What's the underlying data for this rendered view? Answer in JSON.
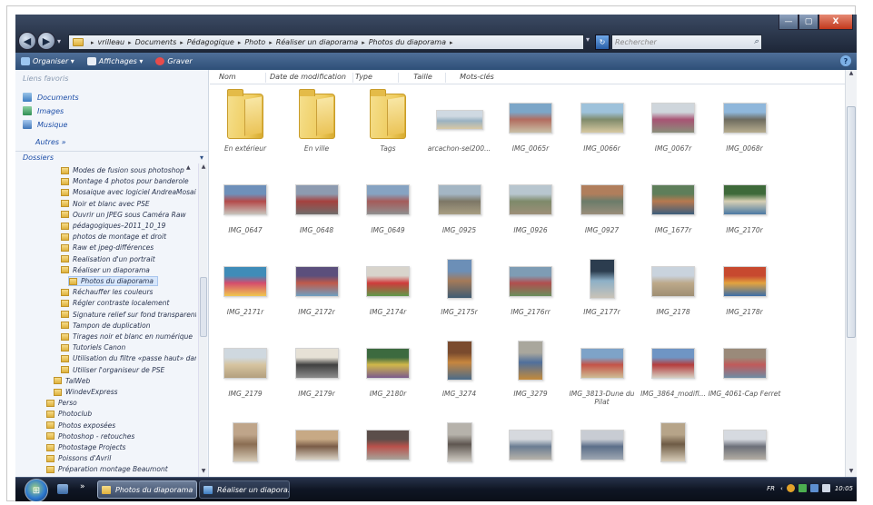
{
  "window": {
    "min_label": "—",
    "max_label": "▢",
    "close_label": "X"
  },
  "breadcrumb": [
    "vrilleau",
    "Documents",
    "Pédagogique",
    "Photo",
    "Réaliser un diaporama",
    "Photos du diaporama"
  ],
  "search": {
    "placeholder": "Rechercher"
  },
  "toolbar": {
    "organize_label": "Organiser ▾",
    "views_label": "Affichages ▾",
    "burn_label": "Graver"
  },
  "favorites": {
    "title": "Liens favoris",
    "items": [
      "Documents",
      "Images",
      "Musique"
    ],
    "more_label": "Autres »"
  },
  "folders_header": "Dossiers",
  "tree": [
    {
      "label": "Modes de fusion sous photoshop",
      "level": 1
    },
    {
      "label": "Montage 4 photos pour banderole",
      "level": 1
    },
    {
      "label": "Mosaique avec logiciel AndreaMosaic",
      "level": 1
    },
    {
      "label": "Noir et blanc avec PSE",
      "level": 1
    },
    {
      "label": "Ouvrir un JPEG sous Caméra Raw",
      "level": 1
    },
    {
      "label": "pédagogiques–2011_10_19",
      "level": 1
    },
    {
      "label": "photos de montage et droit",
      "level": 1
    },
    {
      "label": "Raw et jpeg-différences",
      "level": 1
    },
    {
      "label": "Realisation d'un portrait",
      "level": 1
    },
    {
      "label": "Réaliser un diaporama",
      "level": 1
    },
    {
      "label": "Photos du diaporama",
      "level": 2,
      "selected": true
    },
    {
      "label": "Réchauffer les couleurs",
      "level": 1
    },
    {
      "label": "Régler contraste localement",
      "level": 1
    },
    {
      "label": "Signature relief sur fond transparent",
      "level": 1
    },
    {
      "label": "Tampon de duplication",
      "level": 1
    },
    {
      "label": "Tirages noir et blanc en numérique",
      "level": 1
    },
    {
      "label": "Tutoriels Canon",
      "level": 1
    },
    {
      "label": "Utilisation du filtre «passe haut» dans",
      "level": 1
    },
    {
      "label": "Utiliser l'organiseur de PSE",
      "level": 1
    },
    {
      "label": "TalWeb",
      "level": 0
    },
    {
      "label": "WindevExpress",
      "level": 0
    },
    {
      "label": "Perso",
      "level": -1
    },
    {
      "label": "Photoclub",
      "level": -1
    },
    {
      "label": "Photos exposées",
      "level": -1
    },
    {
      "label": "Photoshop - retouches",
      "level": -1
    },
    {
      "label": "Photostage Projects",
      "level": -1
    },
    {
      "label": "Poissons d'Avril",
      "level": -1
    },
    {
      "label": "Préparation montage Beaumont",
      "level": -1
    }
  ],
  "columns": [
    "Nom",
    "Date de modification",
    "Type",
    "Taille",
    "Mots-clés"
  ],
  "items": [
    {
      "name": "En extérieur",
      "kind": "folder"
    },
    {
      "name": "En ville",
      "kind": "folder"
    },
    {
      "name": "Tags",
      "kind": "folder"
    },
    {
      "name": "arcachon-sel200...",
      "kind": "photo",
      "colors": [
        "#cfd9e2",
        "#9ab2c2",
        "#d8c8a4"
      ]
    },
    {
      "name": "IMG_0065r",
      "kind": "photo",
      "colors": [
        "#7ca6c8",
        "#b26c5f",
        "#c9c0a6"
      ]
    },
    {
      "name": "IMG_0066r",
      "kind": "photo",
      "colors": [
        "#9ec2db",
        "#7f8a6b",
        "#d7c9a1"
      ]
    },
    {
      "name": "IMG_0067r",
      "kind": "photo",
      "colors": [
        "#cfd6dc",
        "#a85374",
        "#8a8e7a"
      ]
    },
    {
      "name": "IMG_0068r",
      "kind": "photo",
      "colors": [
        "#8fb7db",
        "#6d6b5f",
        "#b7ad8f"
      ]
    },
    {
      "name": "IMG_0647",
      "kind": "photo",
      "colors": [
        "#6e90ba",
        "#b44a4a",
        "#c7c3bb"
      ]
    },
    {
      "name": "IMG_0648",
      "kind": "photo",
      "colors": [
        "#8d9bb0",
        "#a5413e",
        "#6f6d6b"
      ]
    },
    {
      "name": "IMG_0649",
      "kind": "photo",
      "colors": [
        "#86a3c2",
        "#a55b5a",
        "#8f8f8f"
      ]
    },
    {
      "name": "IMG_0925",
      "kind": "photo",
      "colors": [
        "#a4b6c4",
        "#7d7766",
        "#a89e82"
      ]
    },
    {
      "name": "IMG_0926",
      "kind": "photo",
      "colors": [
        "#b8c6cf",
        "#7e8a6a",
        "#9d8f78"
      ]
    },
    {
      "name": "IMG_0927",
      "kind": "photo",
      "colors": [
        "#b07e5c",
        "#6b7c6a",
        "#9a8d7a"
      ]
    },
    {
      "name": "IMG_1677r",
      "kind": "photo",
      "colors": [
        "#5e7e5a",
        "#b7794f",
        "#3c5d7c"
      ]
    },
    {
      "name": "IMG_2170r",
      "kind": "photo",
      "colors": [
        "#3e6a3a",
        "#d8d0b4",
        "#4a78a3"
      ]
    },
    {
      "name": "IMG_2171r",
      "kind": "photo",
      "colors": [
        "#3f8cb8",
        "#d54c6d",
        "#f0c74e"
      ]
    },
    {
      "name": "IMG_2172r",
      "kind": "photo",
      "colors": [
        "#5b4f7c",
        "#c05a4a",
        "#6e9fc1"
      ]
    },
    {
      "name": "IMG_2174r",
      "kind": "photo",
      "colors": [
        "#d8d4cc",
        "#cf3b3b",
        "#5f9a4a"
      ]
    },
    {
      "name": "IMG_2175r",
      "kind": "photo",
      "colors": [
        "#6c8fb7",
        "#a57a58",
        "#3f5c73"
      ],
      "portrait": true
    },
    {
      "name": "IMG_2176rr",
      "kind": "photo",
      "colors": [
        "#7e9cb4",
        "#b24e4e",
        "#6a8e5c"
      ]
    },
    {
      "name": "IMG_2177r",
      "kind": "photo",
      "colors": [
        "#2c3d4f",
        "#8db0c7",
        "#c9c2b7"
      ],
      "portrait": true
    },
    {
      "name": "IMG_2178",
      "kind": "photo",
      "colors": [
        "#c9d3dd",
        "#bda98a",
        "#9e8e73"
      ]
    },
    {
      "name": "IMG_2178r",
      "kind": "photo",
      "colors": [
        "#c7492f",
        "#e3a33f",
        "#3c6ea8"
      ]
    },
    {
      "name": "IMG_2179",
      "kind": "photo",
      "colors": [
        "#cfd8df",
        "#d6c4a0",
        "#b39f7e"
      ]
    },
    {
      "name": "IMG_2179r",
      "kind": "photo",
      "colors": [
        "#e6e1d6",
        "#404040",
        "#8c8c8c"
      ]
    },
    {
      "name": "IMG_2180r",
      "kind": "photo",
      "colors": [
        "#3c6a3f",
        "#d2b84a",
        "#7a5a8c"
      ]
    },
    {
      "name": "IMG_3274",
      "kind": "photo",
      "colors": [
        "#7a4b2e",
        "#c7863e",
        "#4a6b8a"
      ],
      "portrait": true
    },
    {
      "name": "IMG_3279",
      "kind": "photo",
      "colors": [
        "#a9a79d",
        "#4f6f9c",
        "#c48a3a"
      ],
      "portrait": true
    },
    {
      "name": "IMG_3813-Dune du Pilat",
      "kind": "photo",
      "colors": [
        "#7ea3c8",
        "#c45347",
        "#cdbd95"
      ]
    },
    {
      "name": "IMG_3864_modifi...",
      "kind": "photo",
      "colors": [
        "#6f95c4",
        "#b53d3d",
        "#d5cfc2"
      ]
    },
    {
      "name": "IMG_4061-Cap Ferret",
      "kind": "photo",
      "colors": [
        "#9a8a7a",
        "#c05a5a",
        "#6e8ca4"
      ]
    },
    {
      "name": "",
      "kind": "photo",
      "colors": [
        "#bfa58a",
        "#8a6d52",
        "#d7cbb7"
      ],
      "portrait": true
    },
    {
      "name": "",
      "kind": "photo",
      "colors": [
        "#c7a985",
        "#7a5c47",
        "#d9d1c3"
      ]
    },
    {
      "name": "",
      "kind": "photo",
      "colors": [
        "#5b4e4a",
        "#b9514b",
        "#a7a39a"
      ]
    },
    {
      "name": "",
      "kind": "photo",
      "colors": [
        "#b6b2ab",
        "#5e5650",
        "#d0ccc4"
      ],
      "portrait": true
    },
    {
      "name": "",
      "kind": "photo",
      "colors": [
        "#d6d9de",
        "#6a7c92",
        "#b7b3aa"
      ]
    },
    {
      "name": "",
      "kind": "photo",
      "colors": [
        "#c8ccd3",
        "#5b6e89",
        "#9ea7b2"
      ]
    },
    {
      "name": "",
      "kind": "photo",
      "colors": [
        "#b6a489",
        "#6e5b45",
        "#d8cdb9"
      ],
      "portrait": true
    },
    {
      "name": "",
      "kind": "photo",
      "colors": [
        "#d6dae0",
        "#6c6f79",
        "#b3ada3"
      ]
    }
  ],
  "taskbar": {
    "more_label": "»",
    "task1_label": "Photos du diaporama",
    "task2_label": "Réaliser un diapora...",
    "lang": "FR",
    "arrow": "‹",
    "clock": "10:05"
  }
}
